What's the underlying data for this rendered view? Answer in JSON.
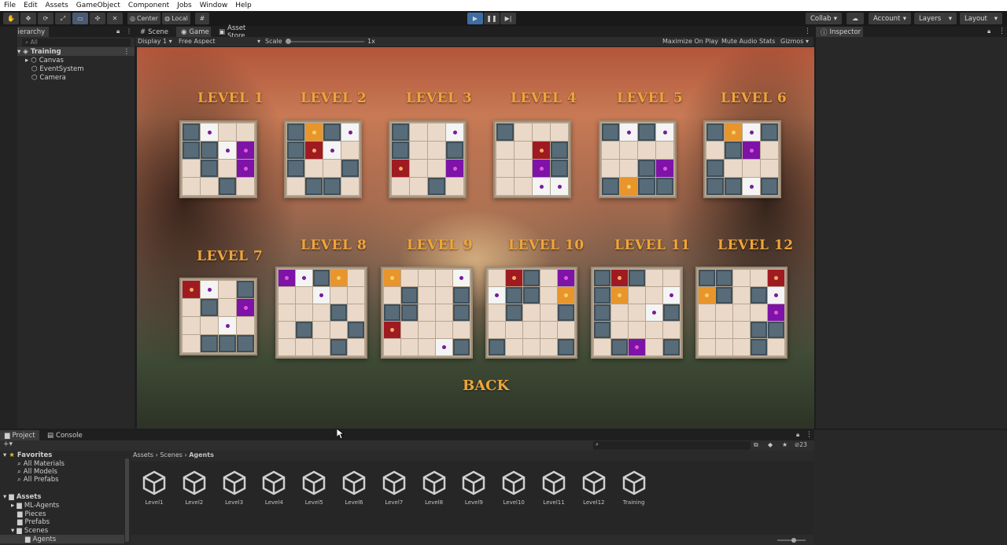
{
  "menu": [
    "File",
    "Edit",
    "Assets",
    "GameObject",
    "Component",
    "Jobs",
    "Window",
    "Help"
  ],
  "toolbar": {
    "pivot": "Center",
    "space": "Local",
    "collab": "Collab",
    "account": "Account",
    "layers": "Layers",
    "layout": "Layout"
  },
  "hierarchy": {
    "tab": "Hierarchy",
    "search_placeholder": "All",
    "scene": "Training",
    "objects": [
      "Canvas",
      "EventSystem",
      "Camera"
    ]
  },
  "center_tabs": [
    "Scene",
    "Game",
    "Asset Store"
  ],
  "game_bar": {
    "display": "Display 1",
    "aspect": "Free Aspect",
    "scale_label": "Scale",
    "scale_value": "1x",
    "maximize": "Maximize On Play",
    "mute": "Mute Audio",
    "stats": "Stats",
    "gizmos": "Gizmos"
  },
  "inspector": {
    "tab": "Inspector"
  },
  "levels": [
    {
      "title": "Level 1",
      "size": 4,
      "cells": [
        "w",
        "l",
        "e",
        "e",
        "w",
        "w",
        "l",
        "p",
        "e",
        "w",
        "e",
        "p",
        "e",
        "e",
        "w",
        "e"
      ]
    },
    {
      "title": "Level 2",
      "size": 4,
      "cells": [
        "w",
        "o",
        "w",
        "l",
        "w",
        "r",
        "l",
        "e",
        "w",
        "e",
        "e",
        "w",
        "e",
        "w",
        "w",
        "e"
      ]
    },
    {
      "title": "Level 3",
      "size": 4,
      "cells": [
        "w",
        "e",
        "e",
        "l",
        "w",
        "e",
        "e",
        "w",
        "r",
        "e",
        "e",
        "p",
        "e",
        "e",
        "w",
        "e"
      ]
    },
    {
      "title": "Level 4",
      "size": 4,
      "cells": [
        "w",
        "e",
        "e",
        "e",
        "e",
        "e",
        "r",
        "w",
        "e",
        "e",
        "p",
        "w",
        "e",
        "e",
        "l",
        "l"
      ]
    },
    {
      "title": "Level 5",
      "size": 4,
      "cells": [
        "w",
        "l",
        "w",
        "l",
        "e",
        "e",
        "e",
        "e",
        "e",
        "e",
        "w",
        "p",
        "w",
        "o",
        "w",
        "w"
      ]
    },
    {
      "title": "Level 6",
      "size": 4,
      "cells": [
        "w",
        "o",
        "l",
        "w",
        "e",
        "w",
        "p",
        "e",
        "w",
        "e",
        "e",
        "e",
        "w",
        "w",
        "l",
        "w"
      ]
    },
    {
      "title": "Level 7",
      "size": 4,
      "cells": [
        "r",
        "l",
        "e",
        "w",
        "e",
        "w",
        "e",
        "p",
        "e",
        "e",
        "l",
        "e",
        "e",
        "w",
        "w",
        "w"
      ]
    },
    {
      "title": "Level 8",
      "size": 5,
      "cells": [
        "p",
        "l",
        "w",
        "o",
        "e",
        "e",
        "e",
        "l",
        "e",
        "e",
        "e",
        "e",
        "e",
        "w",
        "e",
        "e",
        "w",
        "e",
        "e",
        "w",
        "e",
        "e",
        "e",
        "w",
        "e"
      ]
    },
    {
      "title": "Level 9",
      "size": 5,
      "cells": [
        "o",
        "e",
        "e",
        "e",
        "l",
        "e",
        "w",
        "e",
        "e",
        "w",
        "w",
        "w",
        "e",
        "e",
        "w",
        "r",
        "e",
        "e",
        "e",
        "e",
        "e",
        "e",
        "e",
        "l",
        "w"
      ]
    },
    {
      "title": "Level 10",
      "size": 5,
      "cells": [
        "e",
        "r",
        "w",
        "e",
        "p",
        "l",
        "w",
        "w",
        "e",
        "o",
        "e",
        "w",
        "e",
        "e",
        "w",
        "e",
        "e",
        "e",
        "e",
        "e",
        "w",
        "e",
        "e",
        "e",
        "w"
      ]
    },
    {
      "title": "Level 11",
      "size": 5,
      "cells": [
        "w",
        "r",
        "w",
        "e",
        "e",
        "w",
        "o",
        "e",
        "e",
        "l",
        "w",
        "e",
        "e",
        "l",
        "w",
        "w",
        "e",
        "e",
        "e",
        "e",
        "e",
        "w",
        "p",
        "e",
        "w"
      ]
    },
    {
      "title": "Level 12",
      "size": 5,
      "cells": [
        "w",
        "w",
        "e",
        "e",
        "r",
        "o",
        "w",
        "e",
        "w",
        "l",
        "e",
        "e",
        "e",
        "e",
        "p",
        "e",
        "e",
        "e",
        "w",
        "w",
        "e",
        "e",
        "e",
        "w",
        "e"
      ]
    }
  ],
  "back_label": "Back",
  "bottom_tabs": [
    "Project",
    "Console"
  ],
  "project": {
    "favorites_label": "Favorites",
    "favorites": [
      "All Materials",
      "All Models",
      "All Prefabs"
    ],
    "assets_label": "Assets",
    "folders": [
      "ML-Agents",
      "Pieces",
      "Prefabs",
      "Scenes",
      "Agents"
    ],
    "breadcrumb": [
      "Assets",
      "Scenes",
      "Agents"
    ],
    "hidden_count": "23",
    "items": [
      "Level1",
      "Level2",
      "Level3",
      "Level4",
      "Level5",
      "Level6",
      "Level7",
      "Level8",
      "Level9",
      "Level10",
      "Level11",
      "Level12",
      "Training"
    ]
  }
}
